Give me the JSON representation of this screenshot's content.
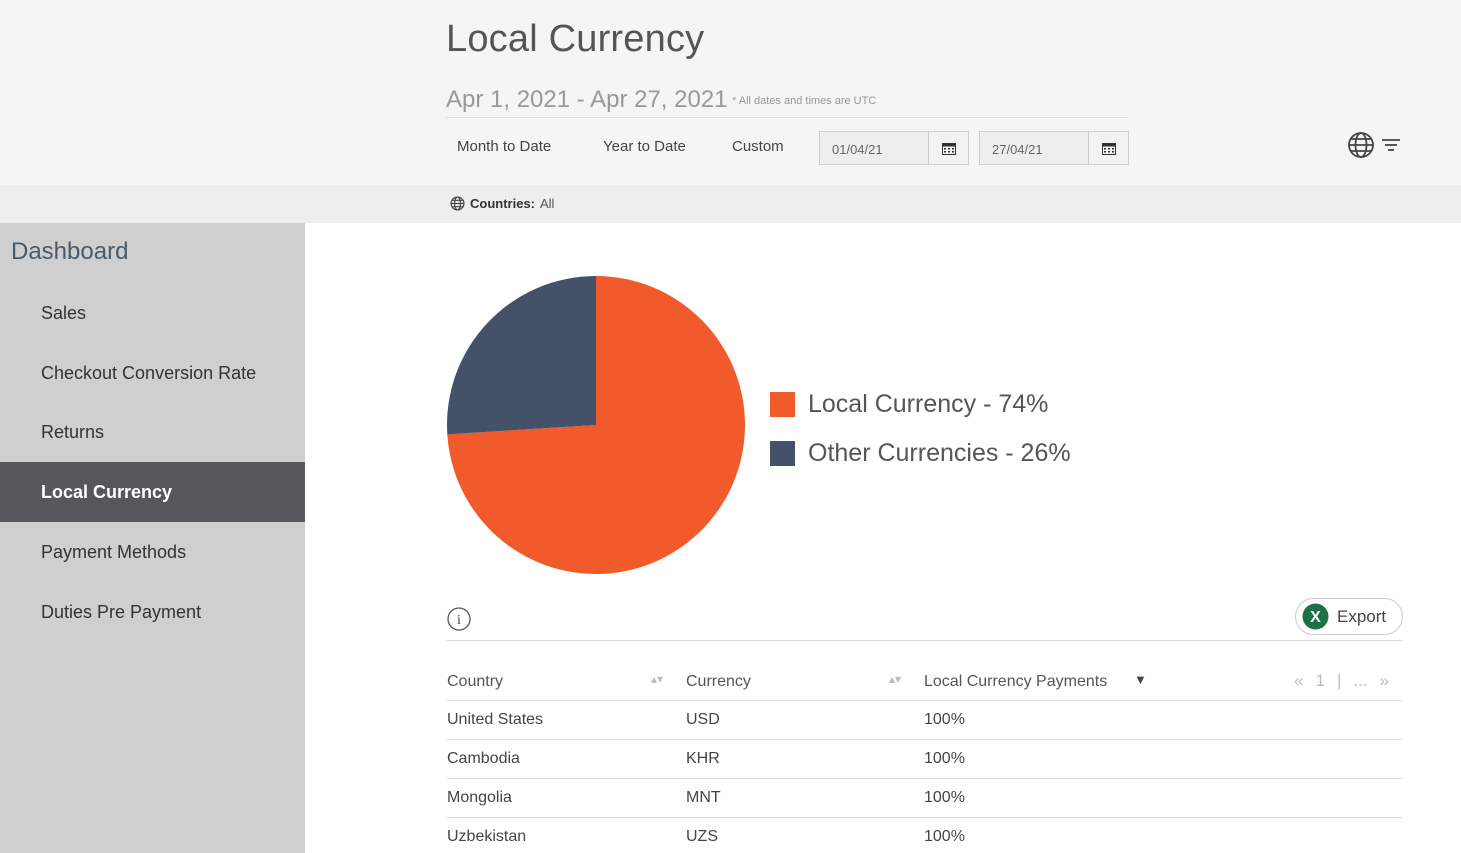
{
  "header": {
    "title": "Local Currency",
    "date_range": "Apr 1, 2021 - Apr 27, 2021",
    "utc_note": "* All dates and times are UTC",
    "presets": [
      "Month to Date",
      "Year to Date",
      "Custom"
    ],
    "start_date": "01/04/21",
    "end_date": "27/04/21"
  },
  "filter": {
    "label": "Countries:",
    "value": "All"
  },
  "sidebar": {
    "heading": "Dashboard",
    "items": [
      {
        "label": "Sales",
        "active": false
      },
      {
        "label": "Checkout Conversion Rate",
        "active": false
      },
      {
        "label": "Returns",
        "active": false
      },
      {
        "label": "Local Currency",
        "active": true
      },
      {
        "label": "Payment Methods",
        "active": false
      },
      {
        "label": "Duties Pre Payment",
        "active": false
      }
    ]
  },
  "chart_data": {
    "type": "pie",
    "slices": [
      {
        "label": "Local Currency - 74%",
        "value": 74,
        "color": "#f15a2b"
      },
      {
        "label": "Other Currencies - 26%",
        "value": 26,
        "color": "#435269"
      }
    ]
  },
  "table": {
    "export_label": "Export",
    "columns": [
      "Country",
      "Currency",
      "Local Currency Payments"
    ],
    "pager": {
      "prev": "«",
      "page": "1",
      "sep": "|",
      "more": "...",
      "next": "»"
    },
    "rows": [
      [
        "United States",
        "USD",
        "100%"
      ],
      [
        "Cambodia",
        "KHR",
        "100%"
      ],
      [
        "Mongolia",
        "MNT",
        "100%"
      ],
      [
        "Uzbekistan",
        "UZS",
        "100%"
      ]
    ]
  },
  "colors": {
    "accent": "#f15a2b",
    "secondary": "#435269",
    "sidebar_bg": "#cfcfcf",
    "sidebar_active": "#55575a",
    "excel_green": "#1e7145"
  }
}
